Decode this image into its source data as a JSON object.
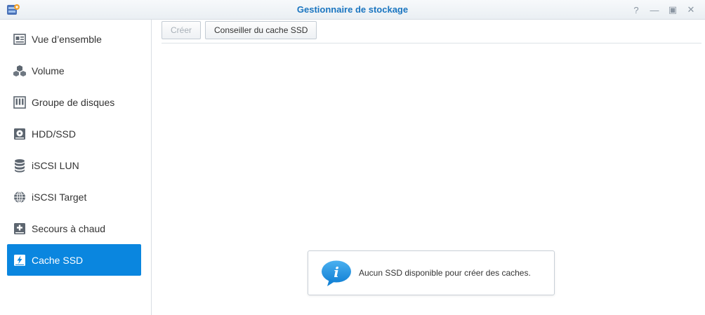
{
  "window": {
    "title": "Gestionnaire de stockage",
    "controls": [
      {
        "name": "help-icon",
        "glyph": "?"
      },
      {
        "name": "minimize-icon",
        "glyph": "—"
      },
      {
        "name": "maximize-icon",
        "glyph": "▣"
      },
      {
        "name": "close-icon",
        "glyph": "✕"
      }
    ]
  },
  "sidebar": {
    "items": [
      {
        "label": "Vue d’ensemble",
        "icon": "overview-icon"
      },
      {
        "label": "Volume",
        "icon": "volume-icon"
      },
      {
        "label": "Groupe de disques",
        "icon": "disk-group-icon"
      },
      {
        "label": "HDD/SSD",
        "icon": "hdd-icon"
      },
      {
        "label": "iSCSI LUN",
        "icon": "database-icon"
      },
      {
        "label": "iSCSI Target",
        "icon": "globe-icon"
      },
      {
        "label": "Secours à chaud",
        "icon": "hot-spare-icon"
      },
      {
        "label": "Cache SSD",
        "icon": "ssd-cache-icon",
        "active": true
      }
    ]
  },
  "toolbar": {
    "create_label": "Créer",
    "advisor_label": "Conseiller du cache SSD"
  },
  "notice": {
    "icon": "info-bubble-icon",
    "text": "Aucun SSD disponible pour créer des caches."
  },
  "colors": {
    "accent": "#0a86df",
    "title": "#1a75c0"
  }
}
